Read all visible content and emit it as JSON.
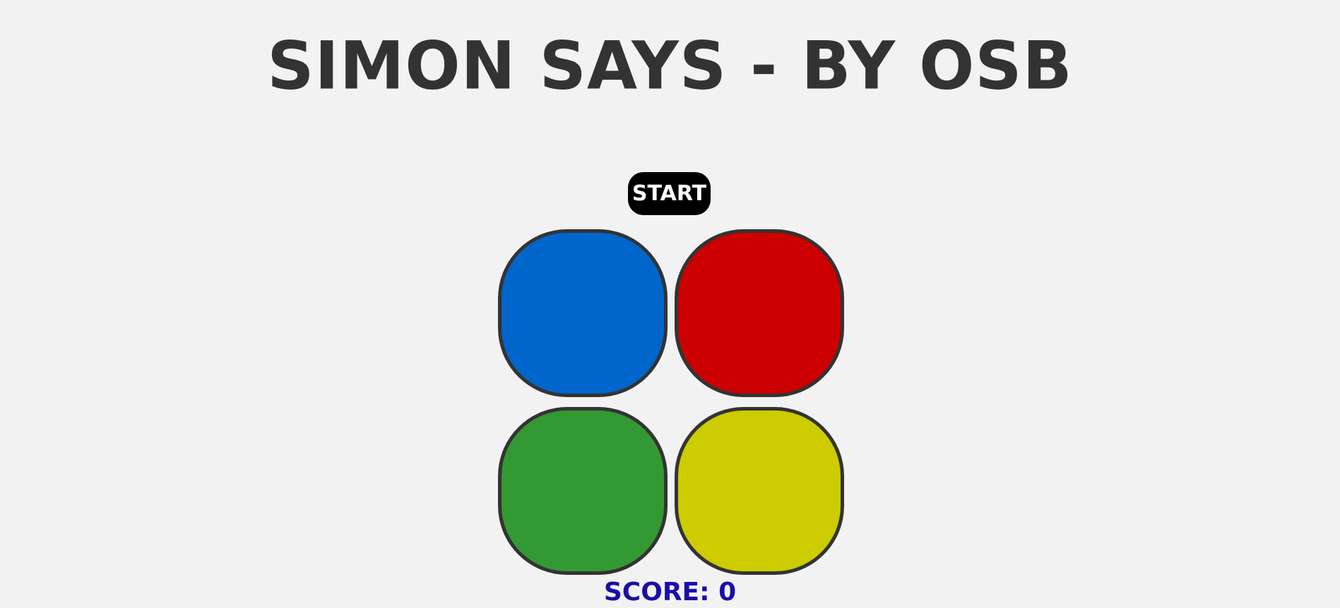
{
  "game": {
    "title": "SIMON SAYS - BY OSB",
    "start_label": "START",
    "score_text": "SCORE: 0",
    "pads": [
      {
        "name": "blue",
        "color": "#0066cc"
      },
      {
        "name": "red",
        "color": "#cc0000"
      },
      {
        "name": "green",
        "color": "#339933"
      },
      {
        "name": "yellow",
        "color": "#cccc00"
      }
    ]
  },
  "colors": {
    "background": "#f2f2f2",
    "title": "#333333",
    "pad_border": "#333333",
    "score": "#1a0ea8",
    "start_bg": "#000000",
    "start_text": "#ffffff"
  }
}
